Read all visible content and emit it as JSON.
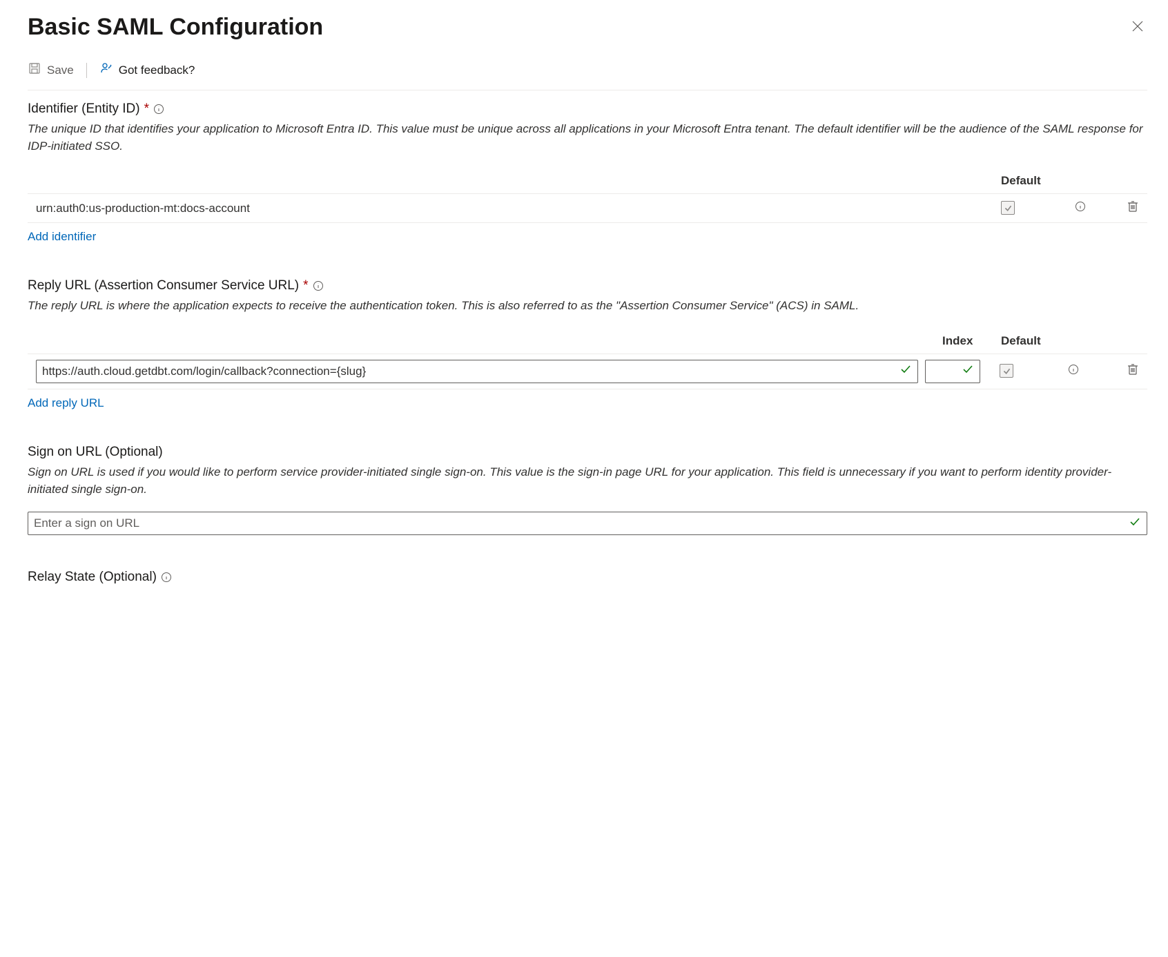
{
  "header": {
    "title": "Basic SAML Configuration"
  },
  "toolbar": {
    "save_label": "Save",
    "feedback_label": "Got feedback?"
  },
  "cols": {
    "index": "Index",
    "default": "Default"
  },
  "identifier": {
    "label": "Identifier (Entity ID)",
    "desc": "The unique ID that identifies your application to Microsoft Entra ID. This value must be unique across all applications in your Microsoft Entra tenant. The default identifier will be the audience of the SAML response for IDP-initiated SSO.",
    "rows": [
      {
        "value": "urn:auth0:us-production-mt:docs-account"
      }
    ],
    "add_link": "Add identifier"
  },
  "reply_url": {
    "label": "Reply URL (Assertion Consumer Service URL)",
    "desc": "The reply URL is where the application expects to receive the authentication token. This is also referred to as the \"Assertion Consumer Service\" (ACS) in SAML.",
    "rows": [
      {
        "value": "https://auth.cloud.getdbt.com/login/callback?connection={slug}",
        "index": ""
      }
    ],
    "add_link": "Add reply URL"
  },
  "sign_on": {
    "label": "Sign on URL (Optional)",
    "desc": "Sign on URL is used if you would like to perform service provider-initiated single sign-on. This value is the sign-in page URL for your application. This field is unnecessary if you want to perform identity provider-initiated single sign-on.",
    "placeholder": "Enter a sign on URL",
    "value": ""
  },
  "relay_state": {
    "label": "Relay State (Optional)"
  }
}
